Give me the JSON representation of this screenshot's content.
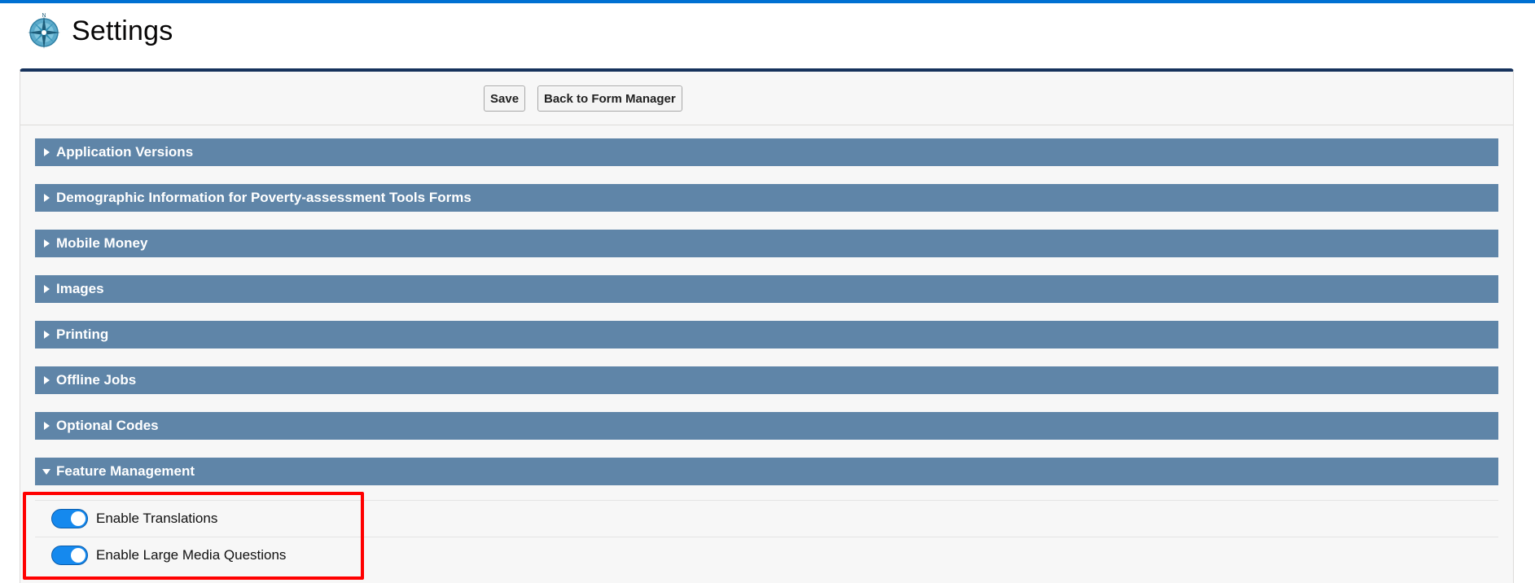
{
  "header": {
    "title": "Settings",
    "logo_icon": "compass-icon"
  },
  "toolbar": {
    "save_label": "Save",
    "back_label": "Back to Form Manager"
  },
  "sections": [
    {
      "label": "Application Versions",
      "expanded": false
    },
    {
      "label": "Demographic Information for Poverty-assessment Tools Forms",
      "expanded": false
    },
    {
      "label": "Mobile Money",
      "expanded": false
    },
    {
      "label": "Images",
      "expanded": false
    },
    {
      "label": "Printing",
      "expanded": false
    },
    {
      "label": "Offline Jobs",
      "expanded": false
    },
    {
      "label": "Optional Codes",
      "expanded": false
    },
    {
      "label": "Feature Management",
      "expanded": true
    }
  ],
  "feature_management": {
    "toggles": [
      {
        "label": "Enable Translations",
        "enabled": true
      },
      {
        "label": "Enable Large Media Questions",
        "enabled": true
      }
    ]
  },
  "colors": {
    "accent": "#0070d2",
    "section_header": "#5f85a8",
    "toggle_on": "#1589ee",
    "highlight": "#ff0000"
  }
}
